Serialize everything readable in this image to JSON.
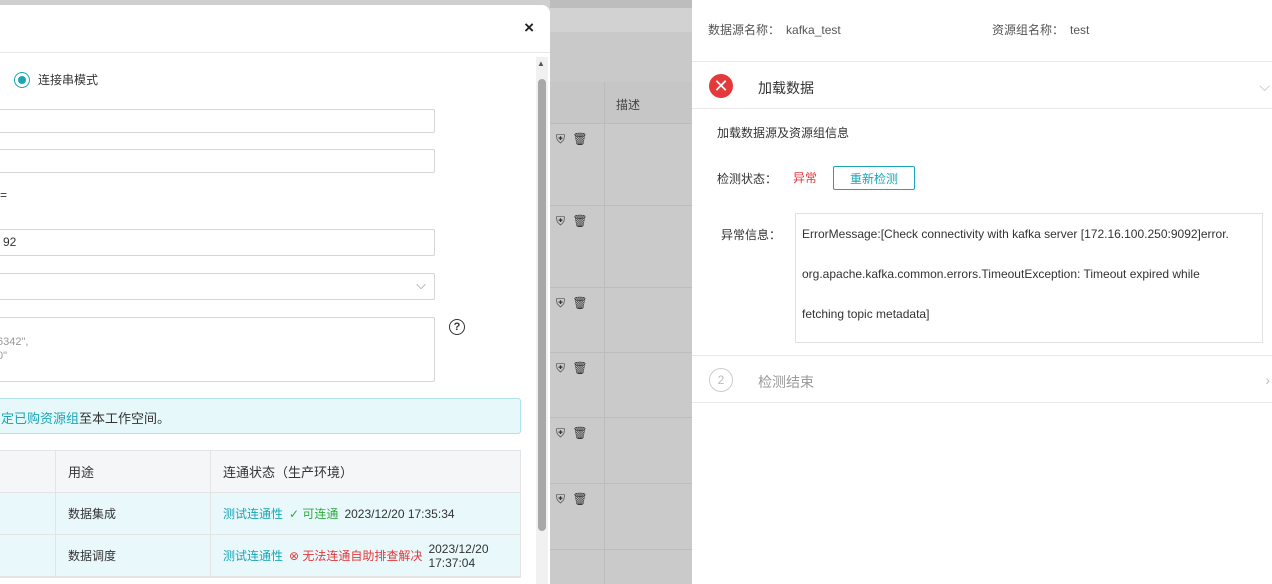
{
  "modal": {
    "close": "×",
    "radio_label": "连接串模式",
    "fields": {
      "frag_label": "=",
      "frag_value": "92",
      "textarea_line1": "6342\",",
      "textarea_line2": "0\""
    },
    "help": "?",
    "notice": {
      "link": "定已购资源组",
      "text": "至本工作空间。"
    },
    "table": {
      "headers": [
        "用途",
        "连通状态（生产环境）"
      ],
      "rows": [
        {
          "usage": "数据集成",
          "test_link": "测试连通性",
          "status": "可连通",
          "status_type": "ok",
          "time": "2023/12/20 17:35:34"
        },
        {
          "usage": "数据调度",
          "test_link": "测试连通性",
          "status": "无法连通自助排查解决",
          "status_type": "error",
          "time": "2023/12/20 17:37:04"
        }
      ]
    }
  },
  "background": {
    "column_header": "描述"
  },
  "drawer": {
    "datasource_label": "数据源名称：",
    "datasource_value": "kafka_test",
    "resource_group_label": "资源组名称：",
    "resource_group_value": "test",
    "step1": {
      "title": "加载数据",
      "subtitle": "加载数据源及资源组信息",
      "status_label": "检测状态：",
      "status_value": "异常",
      "recheck_button": "重新检测",
      "error_label": "异常信息：",
      "error_lines": [
        "ErrorMessage:[Check connectivity with kafka server [172.16.100.250:9092]error.",
        "org.apache.kafka.common.errors.TimeoutException: Timeout expired while",
        "fetching topic metadata]"
      ]
    },
    "step2": {
      "number": "2",
      "title": "检测结束"
    }
  },
  "colors": {
    "accent": "#1aa6b7",
    "error": "#e5383b",
    "success": "#2eab3e"
  }
}
